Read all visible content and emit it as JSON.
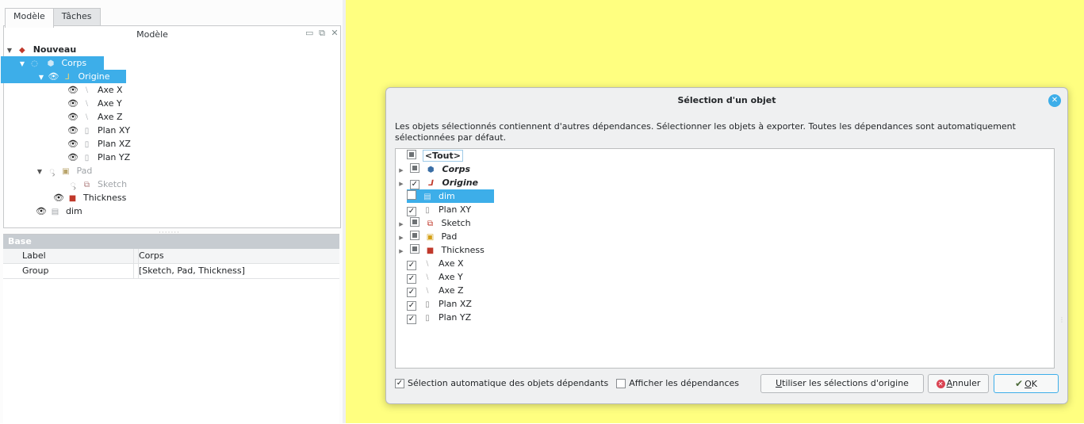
{
  "left": {
    "tabs": [
      "Modèle",
      "Tâches"
    ],
    "tree_header": "Modèle",
    "header_icons": [
      "▭",
      "⧉",
      "✕"
    ],
    "tree": [
      {
        "label": "Nouveau"
      },
      {
        "label": "Corps"
      },
      {
        "label": "Origine"
      },
      {
        "label": "Axe X"
      },
      {
        "label": "Axe Y"
      },
      {
        "label": "Axe Z"
      },
      {
        "label": "Plan XY"
      },
      {
        "label": "Plan XZ"
      },
      {
        "label": "Plan YZ"
      },
      {
        "label": "Pad"
      },
      {
        "label": "Sketch"
      },
      {
        "label": "Thickness"
      },
      {
        "label": "dim"
      }
    ],
    "properties": {
      "group": "Base",
      "rows": [
        {
          "key": "Label",
          "value": "Corps"
        },
        {
          "key": "Group",
          "value": "[Sketch, Pad, Thickness]"
        }
      ]
    }
  },
  "dialog": {
    "title": "Sélection d'un objet",
    "message": "Les objets sélectionnés contiennent d'autres dépendances. Sélectionner les objets à exporter. Toutes les dépendances sont automatiquement sélectionnées par défaut.",
    "items": [
      {
        "label": "<Tout>",
        "state": "partial"
      },
      {
        "label": "Corps",
        "state": "partial"
      },
      {
        "label": "Origine",
        "state": "checked"
      },
      {
        "label": "dim",
        "state": "unchecked"
      },
      {
        "label": "Plan XY",
        "state": "checked"
      },
      {
        "label": "Sketch",
        "state": "partial"
      },
      {
        "label": "Pad",
        "state": "partial"
      },
      {
        "label": "Thickness",
        "state": "partial"
      },
      {
        "label": "Axe X",
        "state": "checked"
      },
      {
        "label": "Axe Y",
        "state": "checked"
      },
      {
        "label": "Axe Z",
        "state": "checked"
      },
      {
        "label": "Plan XZ",
        "state": "checked"
      },
      {
        "label": "Plan YZ",
        "state": "checked"
      }
    ],
    "auto_select_label": "Sélection automatique des objets dépendants",
    "auto_select_checked": true,
    "show_deps_label": "Afficher les dépendances",
    "show_deps_checked": false,
    "btn_use_original_u": "U",
    "btn_use_original_rest": "tiliser les sélections d'origine",
    "btn_cancel_u": "A",
    "btn_cancel_rest": "nnuler",
    "btn_ok_u": "O",
    "btn_ok_rest": "K"
  },
  "colors": {
    "selection": "#3daee9",
    "viewport": "#ffff80",
    "cancel_icon": "#da4453"
  }
}
